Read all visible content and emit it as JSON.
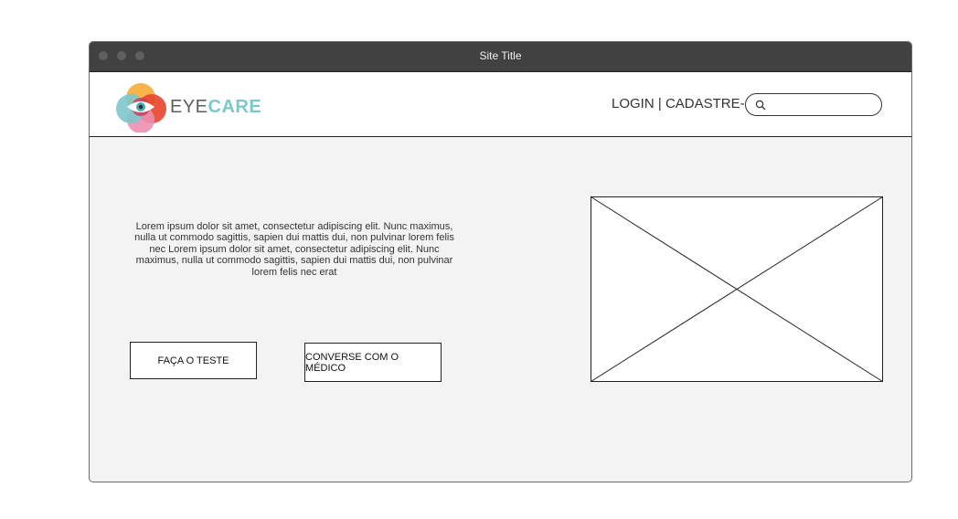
{
  "window": {
    "title": "Site Title"
  },
  "header": {
    "logo": {
      "text_part1": "EYE",
      "text_part2": "CARE",
      "accent_color": "#7cc7cc"
    },
    "auth": {
      "login_label": "LOGIN",
      "separator": "|",
      "signup_label": "CADASTRE-SE"
    },
    "search": {
      "placeholder": "",
      "value": ""
    }
  },
  "hero": {
    "text": "Lorem ipsum dolor sit amet, consectetur adipiscing elit. Nunc maximus, nulla ut commodo sagittis, sapien dui mattis dui, non pulvinar lorem felis nec Lorem ipsum dolor sit amet, consectetur adipiscing elit. Nunc maximus, nulla ut commodo sagittis, sapien dui mattis dui, non pulvinar lorem felis nec erat",
    "buttons": {
      "test_label": "FAÇA O TESTE",
      "doctor_label": "CONVERSE COM O MÉDICO"
    }
  },
  "colors": {
    "titlebar": "#414141",
    "background": "#f3f3f3",
    "logo_accent": "#7cc7cc"
  }
}
